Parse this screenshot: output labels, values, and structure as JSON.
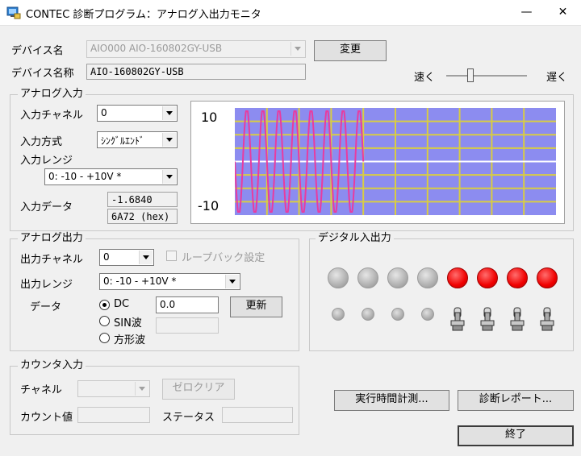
{
  "window": {
    "title": "CONTEC 診断プログラム：アナログ入出力モニタ",
    "minimize_glyph": "—",
    "close_glyph": "✕"
  },
  "device": {
    "name_label": "デバイス名",
    "name_value": "AIO000  AIO-160802GY-USB",
    "change_button": "変更",
    "fullname_label": "デバイス名称",
    "fullname_value": "AIO-160802GY-USB"
  },
  "speed": {
    "fast_label": "速く",
    "slow_label": "遅く",
    "slider_level": 0.3
  },
  "analog_input": {
    "group_title": "アナログ入力",
    "channel_label": "入力チャネル",
    "channel_value": "0",
    "mode_label": "入力方式",
    "mode_value": "ｼﾝｸﾞﾙｴﾝﾄﾞ",
    "range_label": "入力レンジ",
    "range_value": "0: -10 - +10V *",
    "data_label": "入力データ",
    "data_value": "-1.6840",
    "hex_value": "6A72 (hex)"
  },
  "chart_data": {
    "type": "line",
    "y_max_label": "10",
    "y_min_label": "-10",
    "ylim": [
      -10,
      10
    ],
    "grid": true,
    "x_divisions": 10,
    "y_divisions": 8,
    "background_color": "#8c8cf0",
    "grid_color": "#d8cc44",
    "series": [
      {
        "color": "#e83ca0",
        "waveform": "sine",
        "amplitude": 10,
        "cycles": 8,
        "x_extent": 0.4
      }
    ]
  },
  "analog_output": {
    "group_title": "アナログ出力",
    "channel_label": "出力チャネル",
    "channel_value": "0",
    "loopback_label": "ループバック設定",
    "range_label": "出力レンジ",
    "range_value": "0: -10 - +10V *",
    "data_label": "データ",
    "dc_label": "DC",
    "dc_value": "0.0",
    "sin_label": "SIN波",
    "square_label": "方形波",
    "update_button": "更新"
  },
  "digital_io": {
    "group_title": "デジタル入出力",
    "outputs": [
      "off",
      "off",
      "off",
      "off",
      "on",
      "on",
      "on",
      "on"
    ],
    "inputs": [
      "dot",
      "dot",
      "dot",
      "dot",
      "switch",
      "switch",
      "switch",
      "switch"
    ]
  },
  "counter": {
    "group_title": "カウンタ入力",
    "channel_label": "チャネル",
    "clear_button": "ゼロクリア",
    "count_label": "カウント値",
    "status_label": "ステータス"
  },
  "footer": {
    "timing_button": "実行時間計測...",
    "report_button": "診断レポート...",
    "exit_button": "終了"
  }
}
